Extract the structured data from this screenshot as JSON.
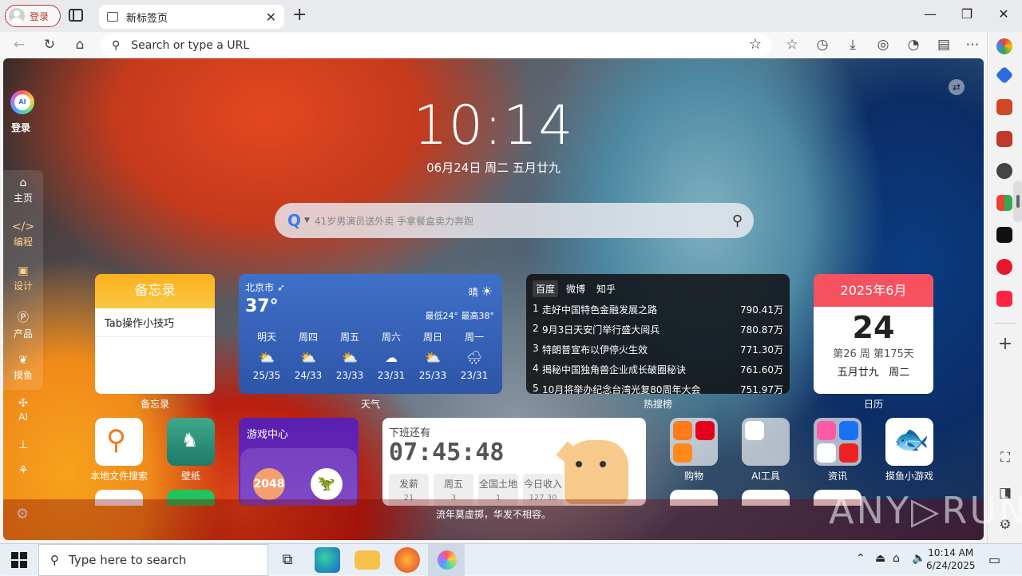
{
  "browser": {
    "profile_label": "登录",
    "tab_title": "新标签页",
    "address_placeholder": "Search  or type a URL"
  },
  "page": {
    "login_label": "登录",
    "nav": [
      {
        "label": "主页",
        "icon": "⌂"
      },
      {
        "label": "编程",
        "icon": "</>"
      },
      {
        "label": "设计",
        "icon": "▣"
      },
      {
        "label": "产品",
        "icon": "Ⓟ"
      },
      {
        "label": "摸鱼",
        "icon": "❦"
      },
      {
        "label": "AI",
        "icon": "✣"
      },
      {
        "label": "",
        "icon": "⊥"
      },
      {
        "label": "",
        "icon": "⚘"
      }
    ],
    "clock": "10:14",
    "date": "06月24日 周二 五月廿九",
    "search_placeholder": "41岁男演员送外卖 手拿餐盒卖力奔跑",
    "memo": {
      "title": "备忘录",
      "item": "Tab操作小技巧",
      "label": "备忘录"
    },
    "weather": {
      "city": "北京市",
      "temp": "37°",
      "condition": "晴",
      "range": "最低24° 最高38°",
      "label": "天气",
      "days": [
        {
          "name": "明天",
          "range": "25/35",
          "icon": "⛅"
        },
        {
          "name": "周四",
          "range": "24/33",
          "icon": "⛅"
        },
        {
          "name": "周五",
          "range": "23/33",
          "icon": "⛅"
        },
        {
          "name": "周六",
          "range": "23/31",
          "icon": "☁"
        },
        {
          "name": "周日",
          "range": "25/33",
          "icon": "⛅"
        },
        {
          "name": "周一",
          "range": "23/31",
          "icon": "🌧"
        }
      ]
    },
    "hot": {
      "label": "热搜榜",
      "tabs": [
        "百度",
        "微博",
        "知乎"
      ],
      "items": [
        {
          "rank": "1",
          "title": "走好中国特色金融发展之路",
          "heat": "790.41万"
        },
        {
          "rank": "2",
          "title": "9月3日天安门举行盛大阅兵",
          "heat": "780.87万"
        },
        {
          "rank": "3",
          "title": "特朗普宣布以伊停火生效",
          "heat": "771.30万"
        },
        {
          "rank": "4",
          "title": "揭秘中国独角兽企业成长破圈秘诀",
          "heat": "761.60万"
        },
        {
          "rank": "5",
          "title": "10月将举办纪念台湾光复80周年大会",
          "heat": "751.97万"
        }
      ]
    },
    "calendar": {
      "header": "2025年6月",
      "day": "24",
      "week": "第26 周 第175天",
      "lunar": "五月廿九",
      "weekday": "周二",
      "label": "日历"
    },
    "apps": {
      "file_search": "本地文件搜索",
      "wallpaper": "壁纸",
      "shopping": "购物",
      "ai_tools": "AI工具",
      "news": "资讯",
      "fish_game": "摸鱼小游戏"
    },
    "game_center": {
      "title": "游戏中心",
      "g2048": "2048",
      "dino": "🦖"
    },
    "offwork": {
      "title": "下班还有",
      "countdown": "07:45:48",
      "cells": [
        {
          "label": "发薪",
          "value": "21"
        },
        {
          "label": "周五",
          "value": "3"
        },
        {
          "label": "全国土地",
          "value": "1"
        },
        {
          "label": "今日收入",
          "value": "127.30"
        }
      ]
    },
    "footer": "流年莫虚掷，华发不相容。"
  },
  "taskbar": {
    "search_placeholder": "Type here to search",
    "time": "10:14 AM",
    "date": "6/24/2025"
  },
  "watermark": "ANY▷RUN"
}
